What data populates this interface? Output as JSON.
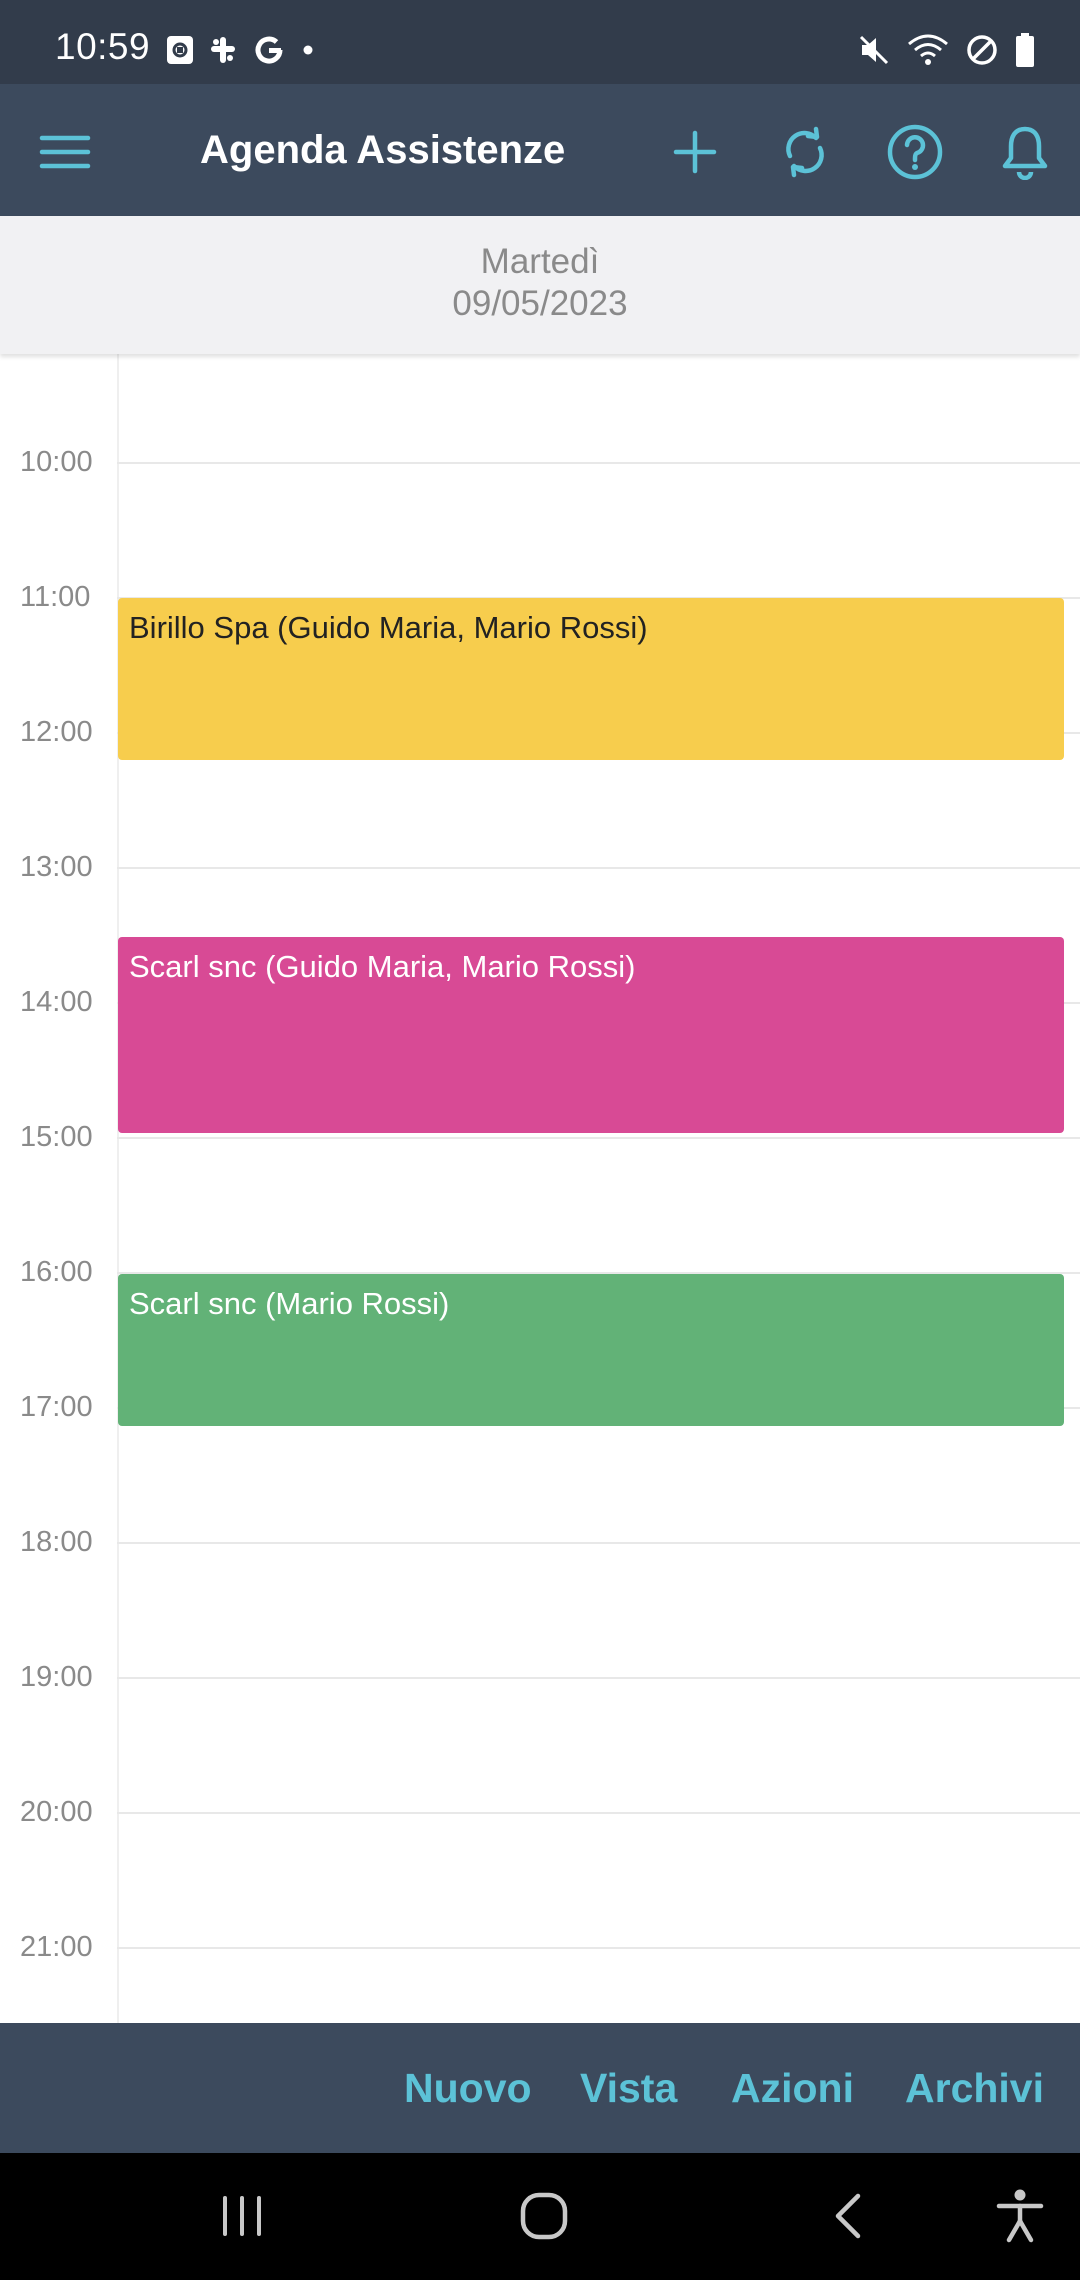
{
  "status_bar": {
    "time": "10:59",
    "left_icons": [
      "calendar-notification-icon",
      "slack-icon",
      "google-icon",
      "dot-icon"
    ],
    "right_icons": [
      "mute-icon",
      "wifi-icon",
      "do-not-disturb-icon",
      "battery-icon"
    ]
  },
  "app_bar": {
    "title": "Agenda Assistenze",
    "actions": [
      "menu-icon",
      "add-icon",
      "sync-icon",
      "help-icon",
      "bell-icon"
    ]
  },
  "date_header": {
    "day": "Martedì",
    "date": "09/05/2023"
  },
  "calendar": {
    "hours": [
      "10:00",
      "11:00",
      "12:00",
      "13:00",
      "14:00",
      "15:00",
      "16:00",
      "17:00",
      "18:00",
      "19:00",
      "20:00",
      "21:00"
    ],
    "events": [
      {
        "title": "Birillo Spa (Guido Maria, Mario Rossi)",
        "color": "#f7cd4d"
      },
      {
        "title": "Scarl snc (Guido Maria, Mario Rossi)",
        "color": "#d84a95"
      },
      {
        "title": "Scarl snc (Mario Rossi)",
        "color": "#62b277"
      }
    ]
  },
  "bottom_bar": {
    "new_label": "Nuovo",
    "view_label": "Vista",
    "actions_label": "Azioni",
    "archives_label": "Archivi"
  },
  "colors": {
    "accent": "#5cc2d7",
    "app_bar": "#3c4a5d",
    "status_bar": "#323c4b"
  }
}
